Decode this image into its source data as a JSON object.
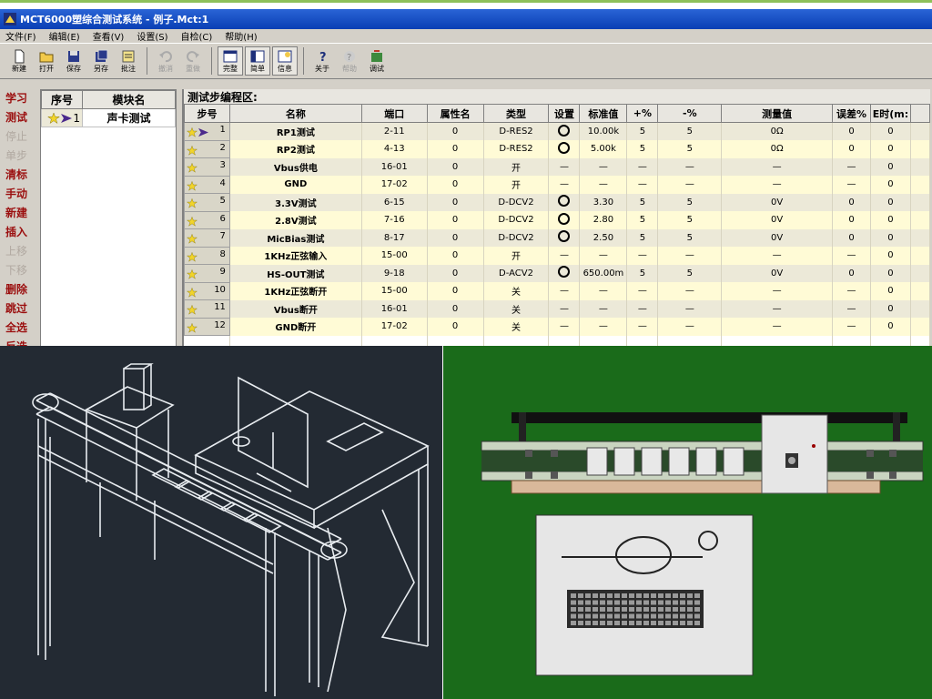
{
  "window": {
    "title": "MCT6000塑综合测试系统 - 例子.Mct:1",
    "menu": [
      "文件(F)",
      "编辑(E)",
      "查看(V)",
      "设置(S)",
      "自检(C)",
      "帮助(H)"
    ],
    "toolbar": [
      {
        "label": "新建",
        "icon": "new-file-icon",
        "enabled": true
      },
      {
        "label": "打开",
        "icon": "open-folder-icon",
        "enabled": true
      },
      {
        "label": "保存",
        "icon": "save-icon",
        "enabled": true
      },
      {
        "label": "另存",
        "icon": "save-as-icon",
        "enabled": true
      },
      {
        "label": "批注",
        "icon": "annotate-icon",
        "enabled": true
      },
      {
        "label": "撤消",
        "icon": "undo-icon",
        "enabled": false
      },
      {
        "label": "重做",
        "icon": "redo-icon",
        "enabled": false
      },
      {
        "label": "完整",
        "icon": "full-view-icon",
        "enabled": true,
        "pressed": true
      },
      {
        "label": "简单",
        "icon": "simple-view-icon",
        "enabled": true,
        "pressed": true
      },
      {
        "label": "信息",
        "icon": "info-icon",
        "enabled": true,
        "pressed": true
      },
      {
        "label": "关于",
        "icon": "about-icon",
        "enabled": true
      },
      {
        "label": "帮助",
        "icon": "help-icon",
        "enabled": false
      },
      {
        "label": "调试",
        "icon": "debug-icon",
        "enabled": true
      }
    ]
  },
  "left_nav": [
    {
      "label": "学习",
      "enabled": true
    },
    {
      "label": "测试",
      "enabled": true
    },
    {
      "label": "停止",
      "enabled": false
    },
    {
      "label": "单步",
      "enabled": false
    },
    {
      "label": "清标",
      "enabled": true
    },
    {
      "label": "手动",
      "enabled": true
    },
    {
      "label": "新建",
      "enabled": true
    },
    {
      "label": "插入",
      "enabled": true
    },
    {
      "label": "上移",
      "enabled": false
    },
    {
      "label": "下移",
      "enabled": false
    },
    {
      "label": "删除",
      "enabled": true
    },
    {
      "label": "跳过",
      "enabled": true
    },
    {
      "label": "全选",
      "enabled": true
    },
    {
      "label": "反选",
      "enabled": true
    }
  ],
  "module_panel": {
    "headers": [
      "序号",
      "模块名"
    ],
    "rows": [
      {
        "index": "1",
        "name": "声卡测试"
      }
    ]
  },
  "program_panel": {
    "title": "测试步编程区:",
    "headers": [
      "步号",
      "名称",
      "端口",
      "属性名",
      "类型",
      "设置",
      "标准值",
      "+%",
      "-%",
      "测量值",
      "误差%",
      "E时(m:"
    ],
    "rows": [
      {
        "step": "1",
        "name": "RP1测试",
        "port": "2-11",
        "attr": "0",
        "type": "D-RES2",
        "set": true,
        "std": "10.00k",
        "plus": "5",
        "minus": "5",
        "meas": "0Ω",
        "err": "0",
        "time": "0"
      },
      {
        "step": "2",
        "name": "RP2测试",
        "port": "4-13",
        "attr": "0",
        "type": "D-RES2",
        "set": true,
        "std": "5.00k",
        "plus": "5",
        "minus": "5",
        "meas": "0Ω",
        "err": "0",
        "time": "0"
      },
      {
        "step": "3",
        "name": "Vbus供电",
        "port": "16-01",
        "attr": "0",
        "type": "开",
        "set": false,
        "std": "—",
        "plus": "—",
        "minus": "—",
        "meas": "—",
        "err": "—",
        "time": "0"
      },
      {
        "step": "4",
        "name": "GND",
        "port": "17-02",
        "attr": "0",
        "type": "开",
        "set": false,
        "std": "—",
        "plus": "—",
        "minus": "—",
        "meas": "—",
        "err": "—",
        "time": "0"
      },
      {
        "step": "5",
        "name": "3.3V测试",
        "port": "6-15",
        "attr": "0",
        "type": "D-DCV2",
        "set": true,
        "std": "3.30",
        "plus": "5",
        "minus": "5",
        "meas": "0V",
        "err": "0",
        "time": "0"
      },
      {
        "step": "6",
        "name": "2.8V测试",
        "port": "7-16",
        "attr": "0",
        "type": "D-DCV2",
        "set": true,
        "std": "2.80",
        "plus": "5",
        "minus": "5",
        "meas": "0V",
        "err": "0",
        "time": "0"
      },
      {
        "step": "7",
        "name": "MicBias测试",
        "port": "8-17",
        "attr": "0",
        "type": "D-DCV2",
        "set": true,
        "std": "2.50",
        "plus": "5",
        "minus": "5",
        "meas": "0V",
        "err": "0",
        "time": "0"
      },
      {
        "step": "8",
        "name": "1KHz正弦输入",
        "port": "15-00",
        "attr": "0",
        "type": "开",
        "set": false,
        "std": "—",
        "plus": "—",
        "minus": "—",
        "meas": "—",
        "err": "—",
        "time": "0"
      },
      {
        "step": "9",
        "name": "HS-OUT测试",
        "port": "9-18",
        "attr": "0",
        "type": "D-ACV2",
        "set": true,
        "std": "650.00m",
        "plus": "5",
        "minus": "5",
        "meas": "0V",
        "err": "0",
        "time": "0"
      },
      {
        "step": "10",
        "name": "1KHz正弦断开",
        "port": "15-00",
        "attr": "0",
        "type": "关",
        "set": false,
        "std": "—",
        "plus": "—",
        "minus": "—",
        "meas": "—",
        "err": "—",
        "time": "0"
      },
      {
        "step": "11",
        "name": "Vbus断开",
        "port": "16-01",
        "attr": "0",
        "type": "关",
        "set": false,
        "std": "—",
        "plus": "—",
        "minus": "—",
        "meas": "—",
        "err": "—",
        "time": "0"
      },
      {
        "step": "12",
        "name": "GND断开",
        "port": "17-02",
        "attr": "0",
        "type": "关",
        "set": false,
        "std": "—",
        "plus": "—",
        "minus": "—",
        "meas": "—",
        "err": "—",
        "time": "0"
      }
    ]
  },
  "colors": {
    "nav_text": "#9b0f0f",
    "row_odd": "#ece9d8",
    "row_even": "#fffbd6",
    "titlebar": "#2a64d6",
    "accent_top": "#8dc05a",
    "cad_background": "#232a33",
    "render_background": "#1a6b1a"
  }
}
